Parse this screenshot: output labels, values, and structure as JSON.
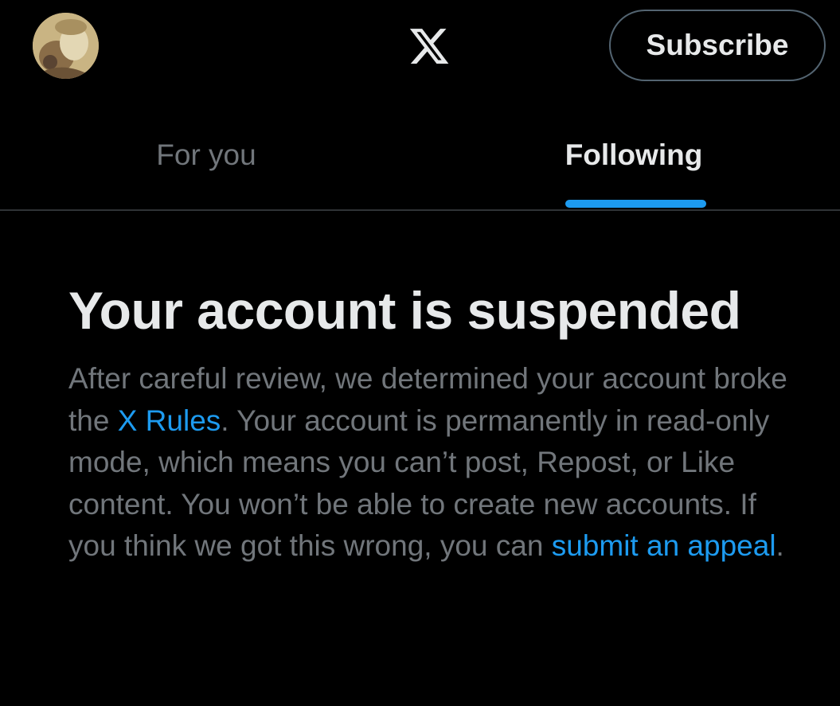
{
  "header": {
    "avatar_icon": "profile-avatar",
    "logo_icon": "x-logo-icon",
    "subscribe_label": "Subscribe"
  },
  "tabs": [
    {
      "label": "For you",
      "active": false
    },
    {
      "label": "Following",
      "active": true
    }
  ],
  "notice": {
    "title": "Your account is suspended",
    "body_part1": "After careful review, we determined your account broke the ",
    "rules_link": "X Rules",
    "body_part2": ". Your account is permanently in read-only mode, which means you can’t post, Repost, or Like content. You won’t be able to create new accounts. If you think we got this wrong, you can ",
    "appeal_link": "submit an appeal",
    "body_part3": "."
  },
  "colors": {
    "background": "#000000",
    "primary_text": "#e7e9ea",
    "secondary_text": "#71767b",
    "accent": "#1d9bf0",
    "border": "#2f3336"
  }
}
